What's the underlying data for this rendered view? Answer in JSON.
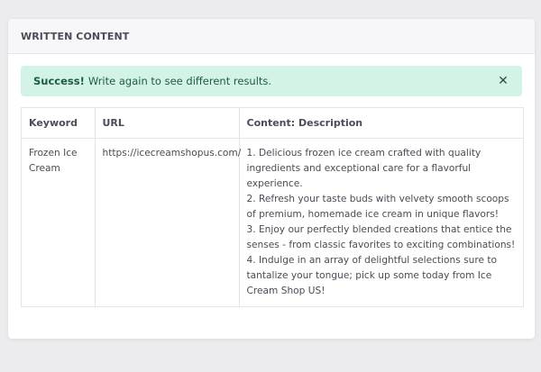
{
  "card": {
    "title": "WRITTEN CONTENT"
  },
  "alert": {
    "strong": "Success!",
    "message": "Write again to see different results.",
    "close_glyph": "✕",
    "bg_color": "#d3f3e7"
  },
  "table": {
    "headers": [
      "Keyword",
      "URL",
      "Content: Description"
    ],
    "rows": [
      {
        "keyword": "Frozen Ice Cream",
        "url": "https://icecreamshopus.com/",
        "description": [
          "1. Delicious frozen ice cream crafted with quality ingredients and exceptional care for a flavorful experience.",
          "2. Refresh your taste buds with velvety smooth scoops of premium, homemade ice cream in unique flavors!",
          "3. Enjoy our perfectly blended creations that entice the senses - from classic favorites to exciting combinations!",
          "4. Indulge in an array of delightful selections sure to tantalize your tongue; pick up some today from Ice Cream Shop US!"
        ]
      }
    ]
  }
}
